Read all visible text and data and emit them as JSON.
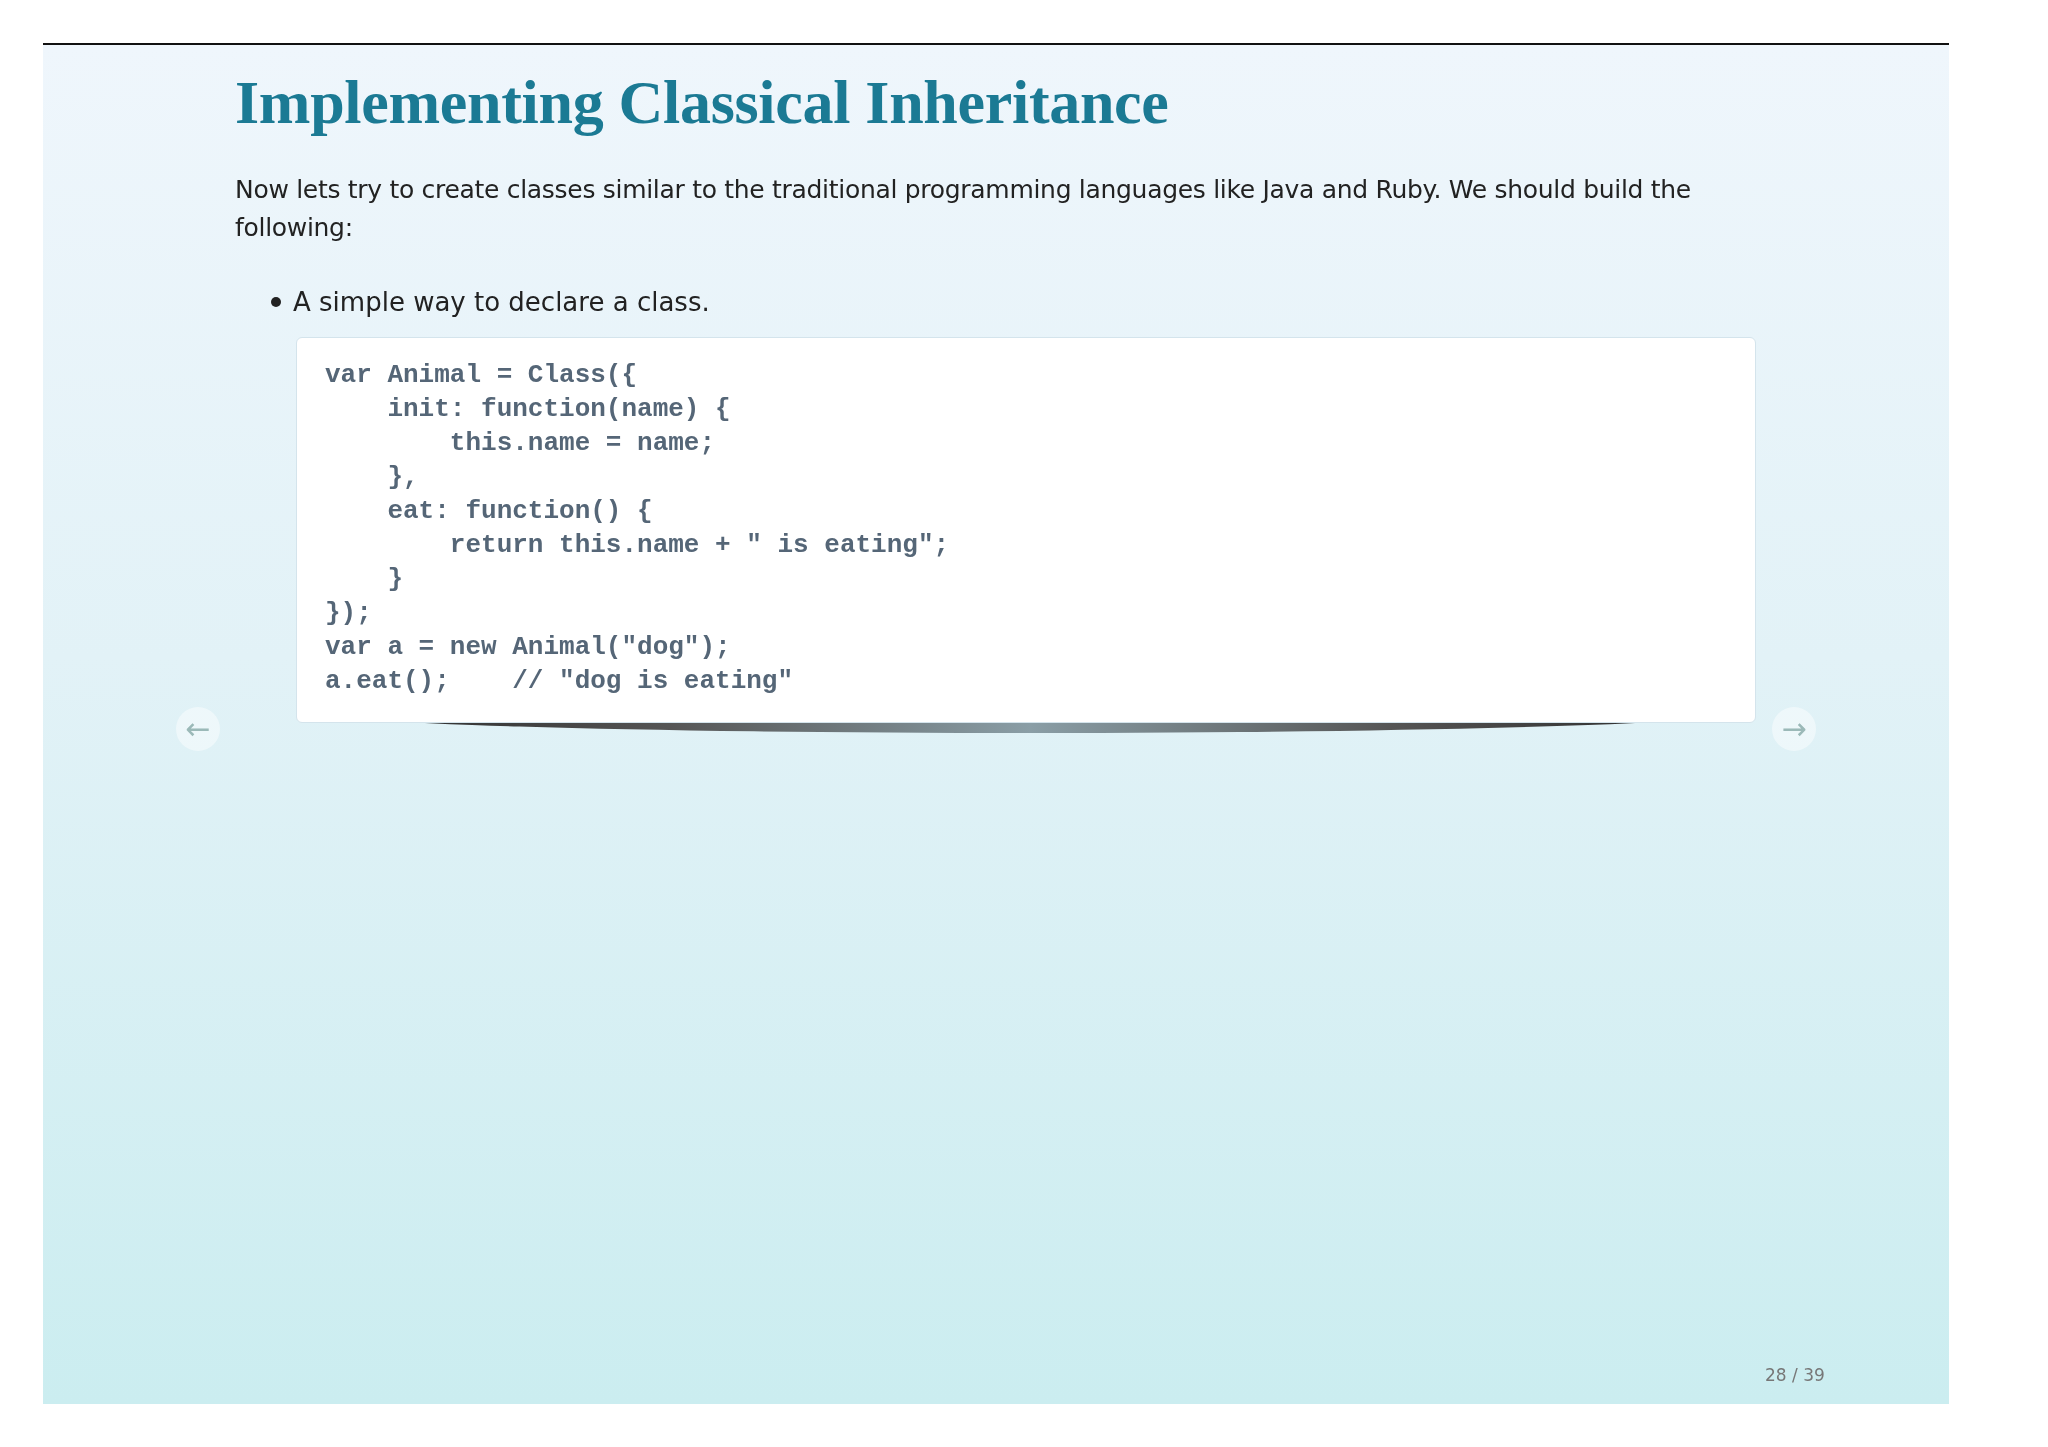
{
  "slide": {
    "title": "Implementing Classical Inheritance",
    "intro": "Now lets try to create classes similar to the traditional programming languages like Java and Ruby. We should build the following:",
    "bullets": [
      "A simple way to declare a class."
    ],
    "code": {
      "lines": [
        "var Animal = Class({",
        "    init: function(name) {",
        "        this.name = name;",
        "    },",
        "    eat: function() {",
        "        return this.name + \" is eating\";",
        "    }",
        "});",
        "var a = new Animal(\"dog\");",
        "a.eat();    // \"dog is eating\""
      ]
    },
    "nav": [
      {
        "kind": "prev",
        "label": "←"
      },
      {
        "kind": "next",
        "label": "→"
      }
    ],
    "page_number": "28 / 39"
  }
}
